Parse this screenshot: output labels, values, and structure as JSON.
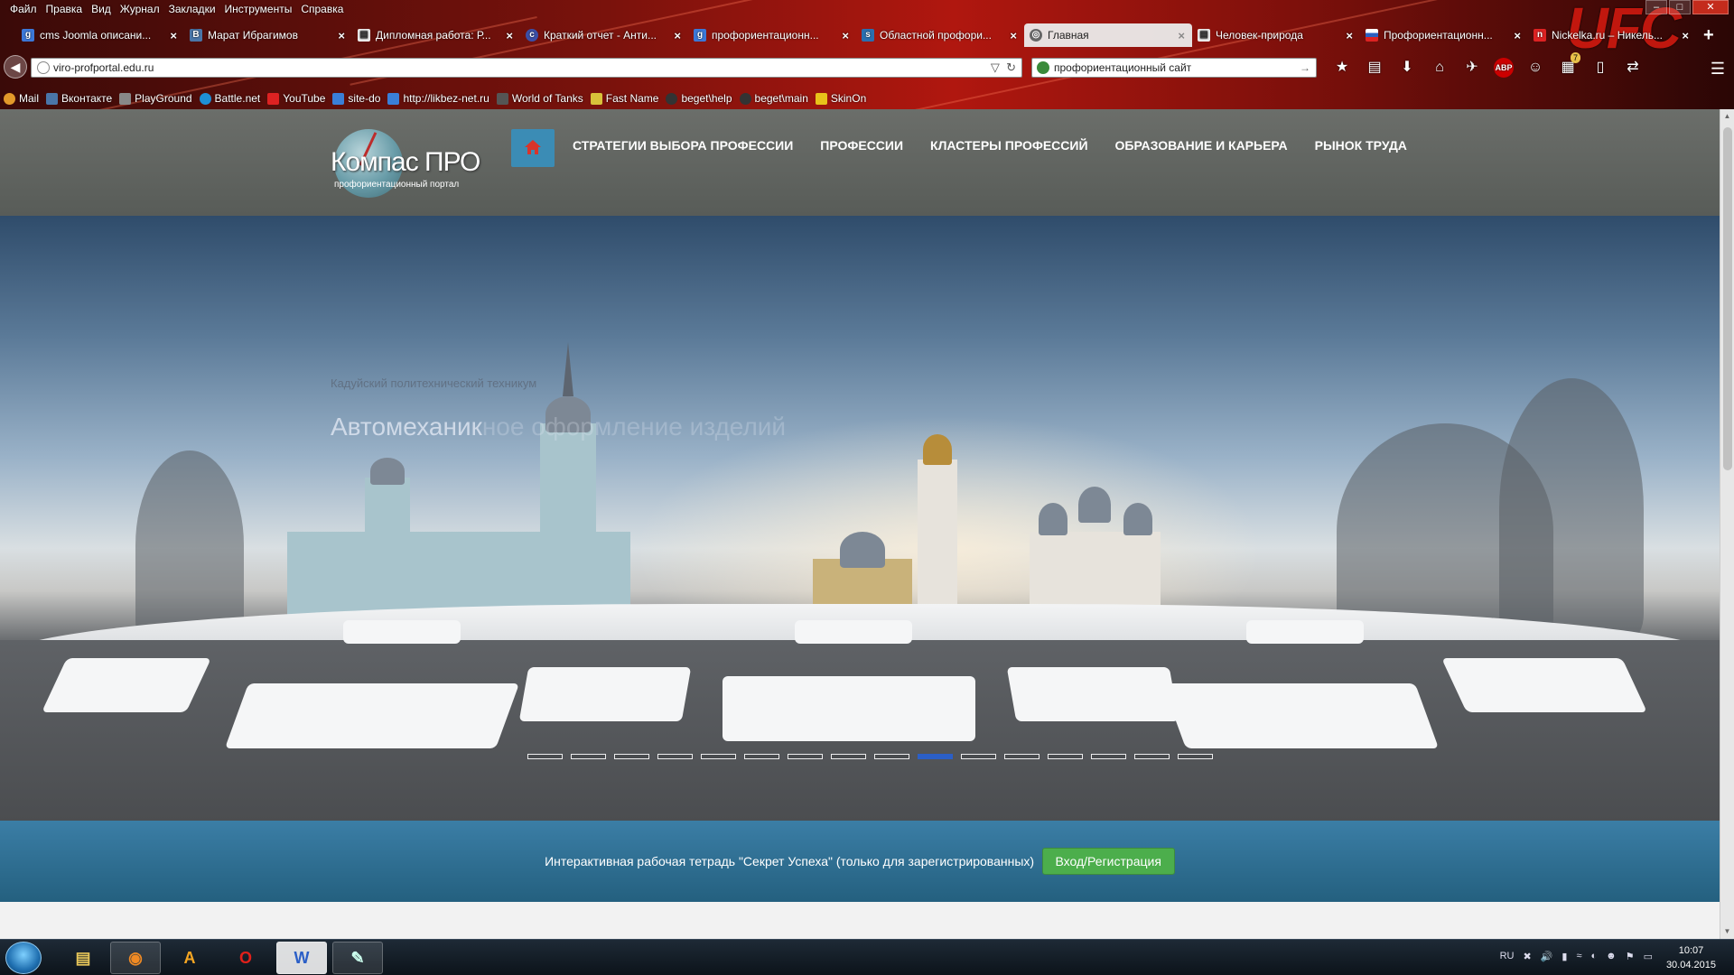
{
  "browser": {
    "menu": [
      "Файл",
      "Правка",
      "Вид",
      "Журнал",
      "Закладки",
      "Инструменты",
      "Справка"
    ],
    "tabs": [
      {
        "title": "cms Joomla описани...",
        "icon": "google-icon",
        "active": false
      },
      {
        "title": "Марат Ибрагимов",
        "icon": "vk-icon",
        "active": false
      },
      {
        "title": "Дипломная работа: Р...",
        "icon": "document-icon",
        "active": false
      },
      {
        "title": "Краткий отчет - Анти...",
        "icon": "antiplagiat-icon",
        "active": false
      },
      {
        "title": "профориентационн...",
        "icon": "google-icon",
        "active": false
      },
      {
        "title": "Областной профори...",
        "icon": "site-icon",
        "active": false
      },
      {
        "title": "Главная",
        "icon": "compass-icon",
        "active": true
      },
      {
        "title": "Человек-природа",
        "icon": "document-icon",
        "active": false
      },
      {
        "title": "Профориентационн...",
        "icon": "flag-icon",
        "active": false
      },
      {
        "title": "Nickelka.ru – Никель...",
        "icon": "nickelka-icon",
        "active": false
      }
    ],
    "url": "viro-profportal.edu.ru",
    "search_query": "профориентационный сайт",
    "bookmarks": [
      "Mail",
      "Вконтакте",
      "PlayGround",
      "Battle.net",
      "YouTube",
      "site-do",
      "http://likbez-net.ru",
      "World of Tanks",
      "Fast Name",
      "beget\\help",
      "beget\\main",
      "SkinOn"
    ],
    "new_tab_label": "+",
    "back_glyph": "◀",
    "reload_glyph": "↻",
    "go_glyph": "→",
    "dropdown_glyph": "▽",
    "menu_glyph": "☰",
    "window_controls": [
      "–",
      "□",
      "✕"
    ],
    "toolbar_icons": [
      "★",
      "▤",
      "⬇",
      "⌂",
      "✈",
      "ABP",
      "☺",
      "▦",
      "▯",
      "⇄"
    ],
    "addon_badge": "7"
  },
  "site": {
    "logo_text": "Компас ПРО",
    "logo_subtitle": "профориентационный портал",
    "nav": [
      "СТРАТЕГИИ ВЫБОРА ПРОФЕССИИ",
      "ПРОФЕССИИ",
      "КЛАСТЕРЫ ПРОФЕССИЙ",
      "ОБРАЗОВАНИЕ И КАРЬЕРА",
      "РЫНОК ТРУДА"
    ],
    "slider": {
      "subtitle": "Кадуйский политехнический техникум",
      "title": "Автомеханик",
      "title_fading": "ное оформление изделий",
      "dot_count": 16,
      "active_dot": 10
    },
    "infobar_text": "Интерактивная рабочая тетрадь \"Секрет Успеха\" (только для зарегистрированных)",
    "login_button": "Вход/Регистрация"
  },
  "taskbar": {
    "apps": [
      "explorer",
      "firefox",
      "aimp",
      "opera",
      "word",
      "paint"
    ],
    "app_glyphs": [
      "▤",
      "◉",
      "A",
      "O",
      "W",
      "✎"
    ],
    "active_app": "firefox",
    "language": "RU",
    "tray_glyphs": [
      "✖",
      "🔊",
      "▮",
      "≈",
      "◐",
      "☻",
      "⚑",
      "▭"
    ],
    "time": "10:07",
    "date": "30.04.2015"
  },
  "colors": {
    "chrome_red": "#b0170f",
    "site_header": "#62655f",
    "home_btn": "#3b8cb5",
    "infobar": "#2f6f94",
    "login_btn": "#4cae4c",
    "active_dot": "#2b5fc7"
  }
}
